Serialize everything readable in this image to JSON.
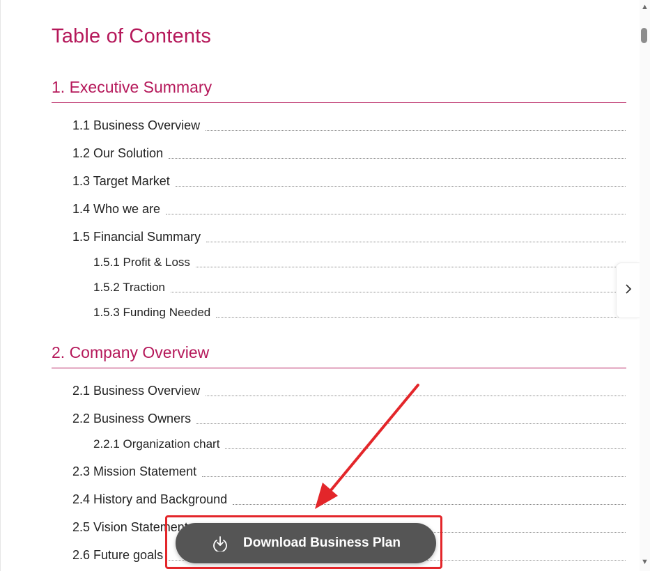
{
  "toc": {
    "title": "Table of Contents",
    "sections": [
      {
        "heading": "1. Executive Summary",
        "items": [
          {
            "label": "1.1 Business Overview",
            "level": 1
          },
          {
            "label": "1.2 Our Solution",
            "level": 1
          },
          {
            "label": "1.3 Target Market",
            "level": 1
          },
          {
            "label": "1.4 Who we are",
            "level": 1
          },
          {
            "label": "1.5 Financial Summary",
            "level": 1
          },
          {
            "label": "1.5.1 Profit & Loss",
            "level": 2
          },
          {
            "label": "1.5.2 Traction",
            "level": 2
          },
          {
            "label": "1.5.3 Funding Needed",
            "level": 2
          }
        ]
      },
      {
        "heading": "2. Company Overview",
        "items": [
          {
            "label": "2.1 Business Overview",
            "level": 1
          },
          {
            "label": "2.2 Business Owners",
            "level": 1
          },
          {
            "label": "2.2.1 Organization chart",
            "level": 2
          },
          {
            "label": "2.3 Mission Statement",
            "level": 1
          },
          {
            "label": "2.4 History and Background",
            "level": 1
          },
          {
            "label": "2.5 Vision Statement",
            "level": 1
          },
          {
            "label": "2.6 Future goals",
            "level": 1
          }
        ]
      }
    ]
  },
  "download_button": {
    "label": "Download Business Plan"
  },
  "icons": {
    "download": "download-icon",
    "side_tab": "chevron-right-icon",
    "scroll_up": "scroll-up-arrow-icon",
    "scroll_down": "scroll-down-arrow-icon",
    "annotation": "red-arrow-icon"
  },
  "colors": {
    "heading": "#b5185a",
    "text": "#222222",
    "button_bg": "#555555",
    "annotation": "#e3262a"
  }
}
